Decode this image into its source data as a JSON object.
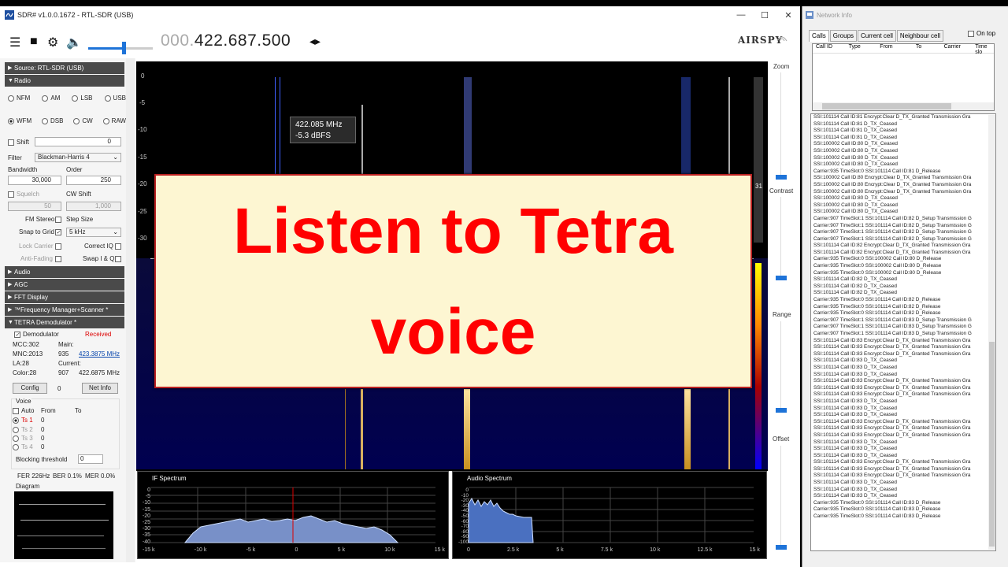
{
  "sdr_window": {
    "title": "SDR# v1.0.0.1672 - RTL-SDR (USB)",
    "controls": [
      "—",
      "☐",
      "✕"
    ]
  },
  "toolbar": {
    "freq_dim": "000.",
    "freq_main": "422.687.500",
    "freq_arrows": "◂▸",
    "brand": "AIRSPY",
    "volume_level": 0.55
  },
  "panel": {
    "source": "Source: RTL-SDR (USB)",
    "radio": "Radio",
    "modes_row1": [
      "NFM",
      "AM",
      "LSB",
      "USB"
    ],
    "modes_row2": [
      "WFM",
      "DSB",
      "CW",
      "RAW"
    ],
    "selected_mode": "WFM",
    "shift_label": "Shift",
    "shift_value": "0",
    "filter_label": "Filter",
    "filter_value": "Blackman-Harris 4",
    "bandwidth_label": "Bandwidth",
    "bandwidth_value": "30,000",
    "order_label": "Order",
    "order_value": "250",
    "squelch_label": "Squelch",
    "cw_shift_label": "CW Shift",
    "squelch_value": "50",
    "cw_shift_value": "1,000",
    "fm_stereo": "FM Stereo",
    "step_size": "Step Size",
    "snap_to_grid": "Snap to Grid",
    "step_value": "5 kHz",
    "lock_carrier": "Lock Carrier",
    "correct_iq": "Correct IQ",
    "anti_fading": "Anti-Fading",
    "swap_iq": "Swap I & Q",
    "audio": "Audio",
    "agc": "AGC",
    "fft_display": "FFT Display",
    "freq_manager": "™Frequency Manager+Scanner *",
    "tetra": "TETRA Demodulator *",
    "demodulator": "Demodulator",
    "received": "Received",
    "mcc": "MCC:302",
    "main_label": "Main:",
    "mnc": "MNC:2013",
    "main_num": "935",
    "main_freq": "423.3875 MHz",
    "la": "LA:28",
    "current_label": "Current:",
    "color": "Color:28",
    "current_num": "907",
    "current_freq": "422.6875 MHz",
    "config": "Config",
    "config_num": "0",
    "net_info": "Net Info",
    "voice": "Voice",
    "auto": "Auto",
    "from": "From",
    "to": "To",
    "timeslots": [
      {
        "name": "Ts 1",
        "val": "0"
      },
      {
        "name": "Ts 2",
        "val": "0"
      },
      {
        "name": "Ts 3",
        "val": "0"
      },
      {
        "name": "Ts 4",
        "val": "0"
      }
    ],
    "blocking_threshold": "Blocking threshold",
    "blocking_value": "0",
    "fer": "FER 226Hz",
    "ber": "BER 0.1%",
    "mer": "MER 0.0%",
    "diagram": "Diagram"
  },
  "fft": {
    "y_ticks": [
      "0",
      "-5",
      "-10",
      "-15",
      "-20",
      "-25",
      "-30"
    ],
    "tooltip_freq": "422.085 MHz",
    "tooltip_level": "-5.3 dBFS",
    "right_num": "31"
  },
  "overlay": {
    "line1": "Listen to Tetra",
    "line2": "voice"
  },
  "rightbar": {
    "zoom": "Zoom",
    "contrast": "Contrast",
    "range": "Range",
    "offset": "Offset"
  },
  "if_spectrum": {
    "label": "IF Spectrum",
    "y_ticks": [
      "0",
      "-5",
      "-10",
      "-15",
      "-20",
      "-25",
      "-30",
      "-35",
      "-40"
    ],
    "x_ticks": [
      "-15 k",
      "-10 k",
      "-5 k",
      "0",
      "5 k",
      "10 k",
      "15 k"
    ]
  },
  "audio_spectrum": {
    "label": "Audio Spectrum",
    "y_ticks": [
      "0",
      "-10",
      "-20",
      "-30",
      "-40",
      "-50",
      "-60",
      "-70",
      "-80",
      "-90",
      "-100"
    ],
    "x_ticks": [
      "0",
      "2.5 k",
      "5 k",
      "7.5 k",
      "10 k",
      "12.5 k",
      "15 k"
    ]
  },
  "network": {
    "title": "Network Info",
    "tabs": [
      "Calls",
      "Groups",
      "Current cell",
      "Neighbour cell"
    ],
    "on_top": "On top",
    "columns": [
      "Call ID",
      "Type",
      "From",
      "To",
      "Carrier",
      "Time slo"
    ],
    "log": [
      "SSI:101114 Call ID:81 Encrypt:Clear D_TX_Granted Transmission Gra",
      "SSI:101114 Call ID:81 D_TX_Ceased",
      "SSI:101114 Call ID:81 D_TX_Ceased",
      "SSI:101114 Call ID:81 D_TX_Ceased",
      "SSI:100002 Call ID:80 D_TX_Ceased",
      "SSI:100002 Call ID:80 D_TX_Ceased",
      "SSI:100002 Call ID:80 D_TX_Ceased",
      "SSI:100002 Call ID:80 D_TX_Ceased",
      "Carrier:935 TimeSlot:0 SSI:101114 Call ID:81 D_Release",
      "SSI:100002 Call ID:80 Encrypt:Clear D_TX_Granted Transmission Gra",
      "SSI:100002 Call ID:80 Encrypt:Clear D_TX_Granted Transmission Gra",
      "SSI:100002 Call ID:80 Encrypt:Clear D_TX_Granted Transmission Gra",
      "SSI:100002 Call ID:80 D_TX_Ceased",
      "SSI:100002 Call ID:80 D_TX_Ceased",
      "SSI:100002 Call ID:80 D_TX_Ceased",
      "Carrier:907 TimeSlot:1 SSI:101114 Call ID:82 D_Setup Transmission G",
      "Carrier:907 TimeSlot:1 SSI:101114 Call ID:82 D_Setup Transmission G",
      "Carrier:907 TimeSlot:1 SSI:101114 Call ID:82 D_Setup Transmission G",
      "Carrier:907 TimeSlot:1 SSI:101114 Call ID:82 D_Setup Transmission G",
      "SSI:101114 Call ID:82 Encrypt:Clear D_TX_Granted Transmission Gra",
      "SSI:101114 Call ID:82 Encrypt:Clear D_TX_Granted Transmission Gra",
      "Carrier:935 TimeSlot:0 SSI:100002 Call ID:80 D_Release",
      "Carrier:935 TimeSlot:0 SSI:100002 Call ID:80 D_Release",
      "Carrier:935 TimeSlot:0 SSI:100002 Call ID:80 D_Release",
      "SSI:101114 Call ID:82 D_TX_Ceased",
      "SSI:101114 Call ID:82 D_TX_Ceased",
      "SSI:101114 Call ID:82 D_TX_Ceased",
      "Carrier:935 TimeSlot:0 SSI:101114 Call ID:82 D_Release",
      "Carrier:935 TimeSlot:0 SSI:101114 Call ID:82 D_Release",
      "Carrier:935 TimeSlot:0 SSI:101114 Call ID:82 D_Release",
      "Carrier:907 TimeSlot:1 SSI:101114 Call ID:83 D_Setup Transmission G",
      "Carrier:907 TimeSlot:1 SSI:101114 Call ID:83 D_Setup Transmission G",
      "Carrier:907 TimeSlot:1 SSI:101114 Call ID:83 D_Setup Transmission G",
      "SSI:101114 Call ID:83 Encrypt:Clear D_TX_Granted Transmission Gra",
      "SSI:101114 Call ID:83 Encrypt:Clear D_TX_Granted Transmission Gra",
      "SSI:101114 Call ID:83 Encrypt:Clear D_TX_Granted Transmission Gra",
      "SSI:101114 Call ID:83 D_TX_Ceased",
      "SSI:101114 Call ID:83 D_TX_Ceased",
      "SSI:101114 Call ID:83 D_TX_Ceased",
      "SSI:101114 Call ID:83 Encrypt:Clear D_TX_Granted Transmission Gra",
      "SSI:101114 Call ID:83 Encrypt:Clear D_TX_Granted Transmission Gra",
      "SSI:101114 Call ID:83 Encrypt:Clear D_TX_Granted Transmission Gra",
      "SSI:101114 Call ID:83 D_TX_Ceased",
      "SSI:101114 Call ID:83 D_TX_Ceased",
      "SSI:101114 Call ID:83 D_TX_Ceased",
      "SSI:101114 Call ID:83 Encrypt:Clear D_TX_Granted Transmission Gra",
      "SSI:101114 Call ID:83 Encrypt:Clear D_TX_Granted Transmission Gra",
      "SSI:101114 Call ID:83 Encrypt:Clear D_TX_Granted Transmission Gra",
      "SSI:101114 Call ID:83 D_TX_Ceased",
      "SSI:101114 Call ID:83 D_TX_Ceased",
      "SSI:101114 Call ID:83 D_TX_Ceased",
      "SSI:101114 Call ID:83 Encrypt:Clear D_TX_Granted Transmission Gra",
      "SSI:101114 Call ID:83 Encrypt:Clear D_TX_Granted Transmission Gra",
      "SSI:101114 Call ID:83 Encrypt:Clear D_TX_Granted Transmission Gra",
      "SSI:101114 Call ID:83 D_TX_Ceased",
      "SSI:101114 Call ID:83 D_TX_Ceased",
      "SSI:101114 Call ID:83 D_TX_Ceased",
      "Carrier:935 TimeSlot:0 SSI:101114 Call ID:83 D_Release",
      "Carrier:935 TimeSlot:0 SSI:101114 Call ID:83 D_Release",
      "Carrier:935 TimeSlot:0 SSI:101114 Call ID:83 D_Release"
    ]
  }
}
